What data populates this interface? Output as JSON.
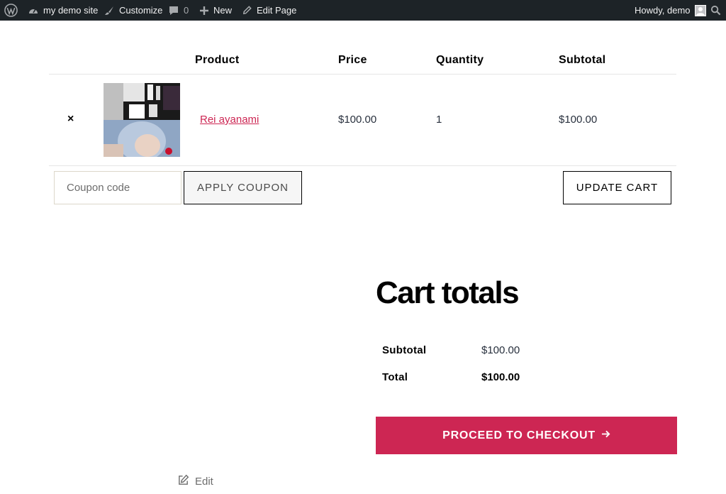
{
  "admin_bar": {
    "site_name": "my demo site",
    "customize": "Customize",
    "comments_count": "0",
    "new": "New",
    "edit_page": "Edit Page",
    "howdy": "Howdy, demo"
  },
  "cart": {
    "headers": {
      "product": "Product",
      "price": "Price",
      "quantity": "Quantity",
      "subtotal": "Subtotal"
    },
    "items": [
      {
        "remove": "×",
        "name": "Rei ayanami",
        "price": "$100.00",
        "quantity": "1",
        "subtotal": "$100.00"
      }
    ],
    "coupon_placeholder": "Coupon code",
    "apply_coupon": "APPLY COUPON",
    "update_cart": "UPDATE CART"
  },
  "totals": {
    "title": "Cart totals",
    "subtotal_label": "Subtotal",
    "subtotal_value": "$100.00",
    "total_label": "Total",
    "total_value": "$100.00",
    "checkout": "PROCEED TO CHECKOUT"
  },
  "footer": {
    "edit": "Edit"
  },
  "colors": {
    "accent": "#cd2653",
    "admin_bar": "#1d2327"
  }
}
